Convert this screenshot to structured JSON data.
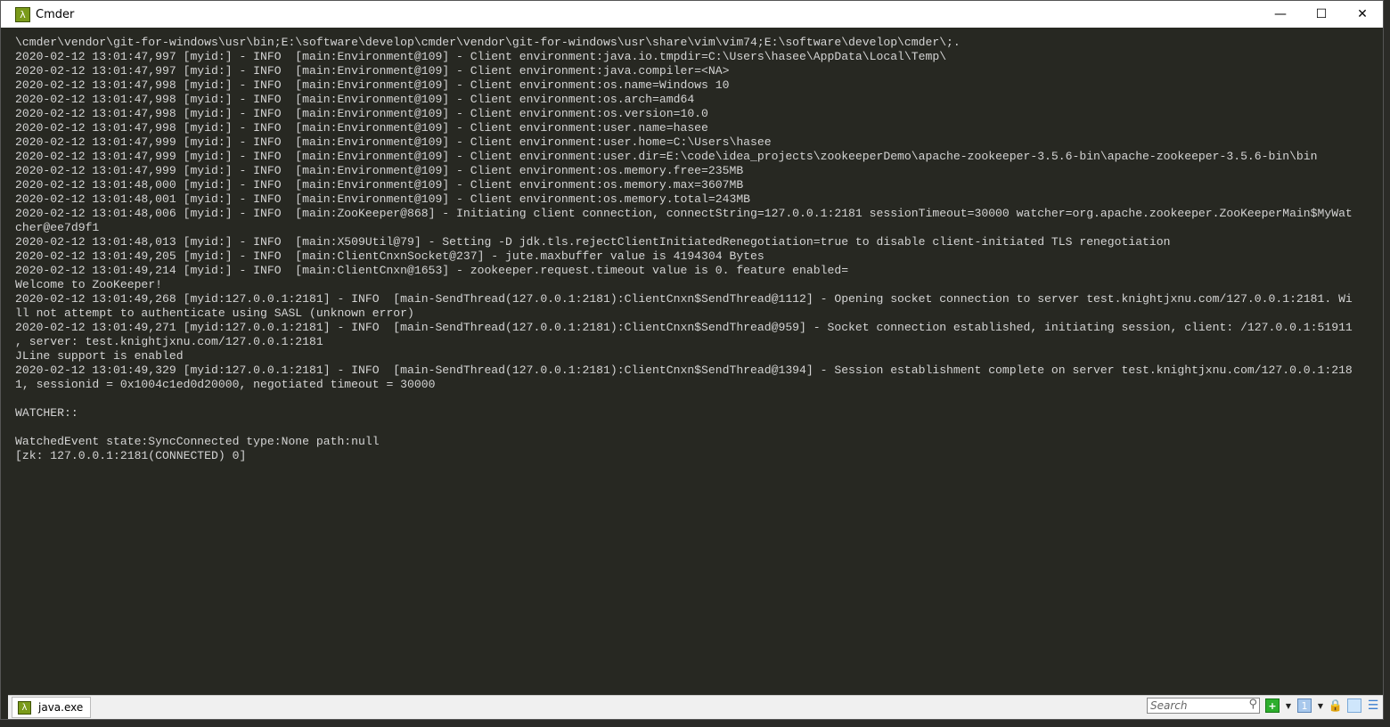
{
  "window": {
    "title": "Cmder",
    "icon": "lambda-icon",
    "controls": [
      "minimize",
      "maximize",
      "close"
    ]
  },
  "console": {
    "lines": [
      "\\cmder\\vendor\\git-for-windows\\usr\\bin;E:\\software\\develop\\cmder\\vendor\\git-for-windows\\usr\\share\\vim\\vim74;E:\\software\\develop\\cmder\\;.",
      "2020-02-12 13:01:47,997 [myid:] - INFO  [main:Environment@109] - Client environment:java.io.tmpdir=C:\\Users\\hasee\\AppData\\Local\\Temp\\",
      "2020-02-12 13:01:47,997 [myid:] - INFO  [main:Environment@109] - Client environment:java.compiler=<NA>",
      "2020-02-12 13:01:47,998 [myid:] - INFO  [main:Environment@109] - Client environment:os.name=Windows 10",
      "2020-02-12 13:01:47,998 [myid:] - INFO  [main:Environment@109] - Client environment:os.arch=amd64",
      "2020-02-12 13:01:47,998 [myid:] - INFO  [main:Environment@109] - Client environment:os.version=10.0",
      "2020-02-12 13:01:47,998 [myid:] - INFO  [main:Environment@109] - Client environment:user.name=hasee",
      "2020-02-12 13:01:47,999 [myid:] - INFO  [main:Environment@109] - Client environment:user.home=C:\\Users\\hasee",
      "2020-02-12 13:01:47,999 [myid:] - INFO  [main:Environment@109] - Client environment:user.dir=E:\\code\\idea_projects\\zookeeperDemo\\apache-zookeeper-3.5.6-bin\\apache-zookeeper-3.5.6-bin\\bin",
      "2020-02-12 13:01:47,999 [myid:] - INFO  [main:Environment@109] - Client environment:os.memory.free=235MB",
      "2020-02-12 13:01:48,000 [myid:] - INFO  [main:Environment@109] - Client environment:os.memory.max=3607MB",
      "2020-02-12 13:01:48,001 [myid:] - INFO  [main:Environment@109] - Client environment:os.memory.total=243MB",
      "2020-02-12 13:01:48,006 [myid:] - INFO  [main:ZooKeeper@868] - Initiating client connection, connectString=127.0.0.1:2181 sessionTimeout=30000 watcher=org.apache.zookeeper.ZooKeeperMain$MyWat",
      "cher@ee7d9f1",
      "2020-02-12 13:01:48,013 [myid:] - INFO  [main:X509Util@79] - Setting -D jdk.tls.rejectClientInitiatedRenegotiation=true to disable client-initiated TLS renegotiation",
      "2020-02-12 13:01:49,205 [myid:] - INFO  [main:ClientCnxnSocket@237] - jute.maxbuffer value is 4194304 Bytes",
      "2020-02-12 13:01:49,214 [myid:] - INFO  [main:ClientCnxn@1653] - zookeeper.request.timeout value is 0. feature enabled=",
      "Welcome to ZooKeeper!",
      "2020-02-12 13:01:49,268 [myid:127.0.0.1:2181] - INFO  [main-SendThread(127.0.0.1:2181):ClientCnxn$SendThread@1112] - Opening socket connection to server test.knightjxnu.com/127.0.0.1:2181. Wi",
      "ll not attempt to authenticate using SASL (unknown error)",
      "2020-02-12 13:01:49,271 [myid:127.0.0.1:2181] - INFO  [main-SendThread(127.0.0.1:2181):ClientCnxn$SendThread@959] - Socket connection established, initiating session, client: /127.0.0.1:51911",
      ", server: test.knightjxnu.com/127.0.0.1:2181",
      "JLine support is enabled",
      "2020-02-12 13:01:49,329 [myid:127.0.0.1:2181] - INFO  [main-SendThread(127.0.0.1:2181):ClientCnxn$SendThread@1394] - Session establishment complete on server test.knightjxnu.com/127.0.0.1:218",
      "1, sessionid = 0x1004c1ed0d20000, negotiated timeout = 30000",
      "",
      "WATCHER::",
      "",
      "WatchedEvent state:SyncConnected type:None path:null",
      "[zk: 127.0.0.1:2181(CONNECTED) 0]"
    ]
  },
  "statusbar": {
    "tab_label": "java.exe",
    "search_placeholder": "Search"
  }
}
